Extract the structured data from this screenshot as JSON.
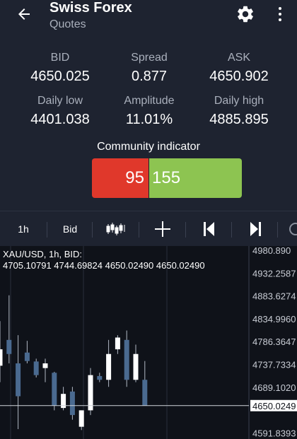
{
  "header": {
    "title": "Swiss Forex",
    "subtitle": "Quotes",
    "icons": {
      "back": "arrow-left-icon",
      "settings": "gear-icon",
      "more": "more-vertical-icon"
    }
  },
  "stats": {
    "bid": {
      "label": "BID",
      "value": "4650.025"
    },
    "spread": {
      "label": "Spread",
      "value": "0.877"
    },
    "ask": {
      "label": "ASK",
      "value": "4650.902"
    },
    "daily_low": {
      "label": "Daily low",
      "value": "4401.038"
    },
    "amplitude": {
      "label": "Amplitude",
      "value": "11.01%"
    },
    "daily_high": {
      "label": "Daily high",
      "value": "4885.895"
    }
  },
  "community": {
    "label": "Community indicator",
    "sell_count": "95",
    "buy_count": "155",
    "colors": {
      "sell": "#e0382b",
      "buy": "#8dc451"
    }
  },
  "toolbar": {
    "timeframe": "1h",
    "price_type": "Bid",
    "icons": [
      "candlestick-icon",
      "crosshair-icon",
      "skip-back-icon",
      "skip-forward-icon",
      "clock-icon"
    ]
  },
  "chart_data": {
    "type": "candlestick",
    "info_line1": "XAU/USD, 1h, BID:",
    "info_line2": "4705.10791 4744.69824 4650.02490 4650.02490",
    "y_ticks": [
      "4980.890",
      "4932.2587",
      "4883.6274",
      "4834.9960",
      "4786.3647",
      "4737.7334",
      "4689.1020",
      "4650.0249",
      "4591.8393"
    ],
    "current_price": "4650.0249",
    "ylim": [
      4578.9,
      4990.0
    ],
    "colors": {
      "up": "#ffffff",
      "down": "#4a6a90",
      "background": "#0f1219",
      "grid": "#2a2f3a"
    },
    "candles": [
      {
        "o": 4735,
        "h": 4830,
        "l": 4700,
        "c": 4770,
        "dir": "up"
      },
      {
        "o": 4790,
        "h": 4885,
        "l": 4740,
        "c": 4760,
        "dir": "down"
      },
      {
        "o": 4740,
        "h": 4800,
        "l": 4600,
        "c": 4670,
        "dir": "down"
      },
      {
        "o": 4763,
        "h": 4788,
        "l": 4740,
        "c": 4745,
        "dir": "down"
      },
      {
        "o": 4744,
        "h": 4750,
        "l": 4710,
        "c": 4715,
        "dir": "down"
      },
      {
        "o": 4730,
        "h": 4750,
        "l": 4700,
        "c": 4740,
        "dir": "up"
      },
      {
        "o": 4720,
        "h": 4722,
        "l": 4640,
        "c": 4650,
        "dir": "down"
      },
      {
        "o": 4645,
        "h": 4690,
        "l": 4640,
        "c": 4675,
        "dir": "up"
      },
      {
        "o": 4680,
        "h": 4690,
        "l": 4620,
        "c": 4630,
        "dir": "down"
      },
      {
        "o": 4605,
        "h": 4640,
        "l": 4598,
        "c": 4640,
        "dir": "up"
      },
      {
        "o": 4640,
        "h": 4730,
        "l": 4630,
        "c": 4715,
        "dir": "up"
      },
      {
        "o": 4713,
        "h": 4720,
        "l": 4700,
        "c": 4705,
        "dir": "down"
      },
      {
        "o": 4705,
        "h": 4790,
        "l": 4690,
        "c": 4760,
        "dir": "up"
      },
      {
        "o": 4770,
        "h": 4800,
        "l": 4760,
        "c": 4795,
        "dir": "up"
      },
      {
        "o": 4790,
        "h": 4810,
        "l": 4690,
        "c": 4705,
        "dir": "down"
      },
      {
        "o": 4705,
        "h": 4780,
        "l": 4700,
        "c": 4760,
        "dir": "up"
      },
      {
        "o": 4705,
        "h": 4745,
        "l": 4650,
        "c": 4650,
        "dir": "down"
      }
    ]
  }
}
